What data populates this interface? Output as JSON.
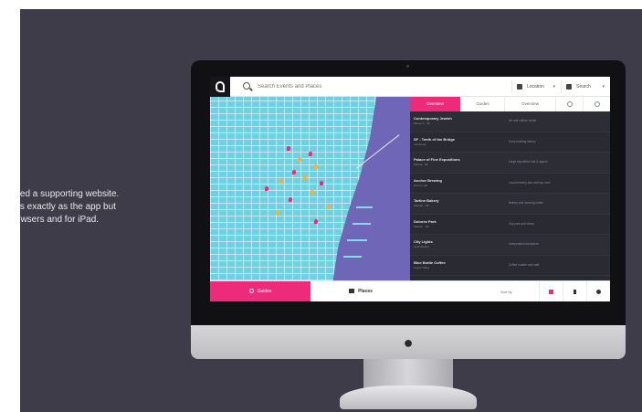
{
  "caption": {
    "lines": [
      "eated a supporting website.",
      "orks exactly as the app but",
      "browsers and for iPad."
    ]
  },
  "topbar": {
    "search_placeholder": "Search Events and Places",
    "location_label": "Location",
    "menu_label": "Search"
  },
  "tabs": [
    "Overview",
    "Guides",
    "Overview"
  ],
  "list": [
    {
      "name": "Contemporary Jewish",
      "sub": "Museum · SF",
      "desc": "Art and culture center"
    },
    {
      "name": "SF - Tenth of the Bridge",
      "sub": "Landmark",
      "desc": "Ferry building history"
    },
    {
      "name": "Palace of Fine Expositions",
      "sub": "Marina · SF",
      "desc": "Large exposition hall & lagoon"
    },
    {
      "name": "Anchor Brewing",
      "sub": "Potrero Hill",
      "desc": "Local brewery tour and tap room"
    },
    {
      "name": "Tartine Bakery",
      "sub": "Mission · SF",
      "desc": "Bakery and morning coffee"
    },
    {
      "name": "Dolores Park",
      "sub": "Mission · SF",
      "desc": "City park and views"
    },
    {
      "name": "City Lights",
      "sub": "North Beach",
      "desc": "Independent bookstore"
    },
    {
      "name": "Blue Bottle Coffee",
      "sub": "Hayes Valley",
      "desc": "Coffee roaster and café"
    }
  ],
  "bottombar": {
    "guides_label": "Guides",
    "places_label": "Places",
    "sort_label": "Sort by"
  },
  "colors": {
    "accent": "#ee2a7b",
    "map_land": "#6fd0e4",
    "map_water": "#6f66b8",
    "panel_bg": "#2a2a32",
    "backdrop": "#3e3c48"
  },
  "icons": {
    "logo": "app-logo-icon",
    "search": "search-icon",
    "location": "location-icon",
    "menu": "menu-icon",
    "apple": "apple-logo-icon"
  }
}
